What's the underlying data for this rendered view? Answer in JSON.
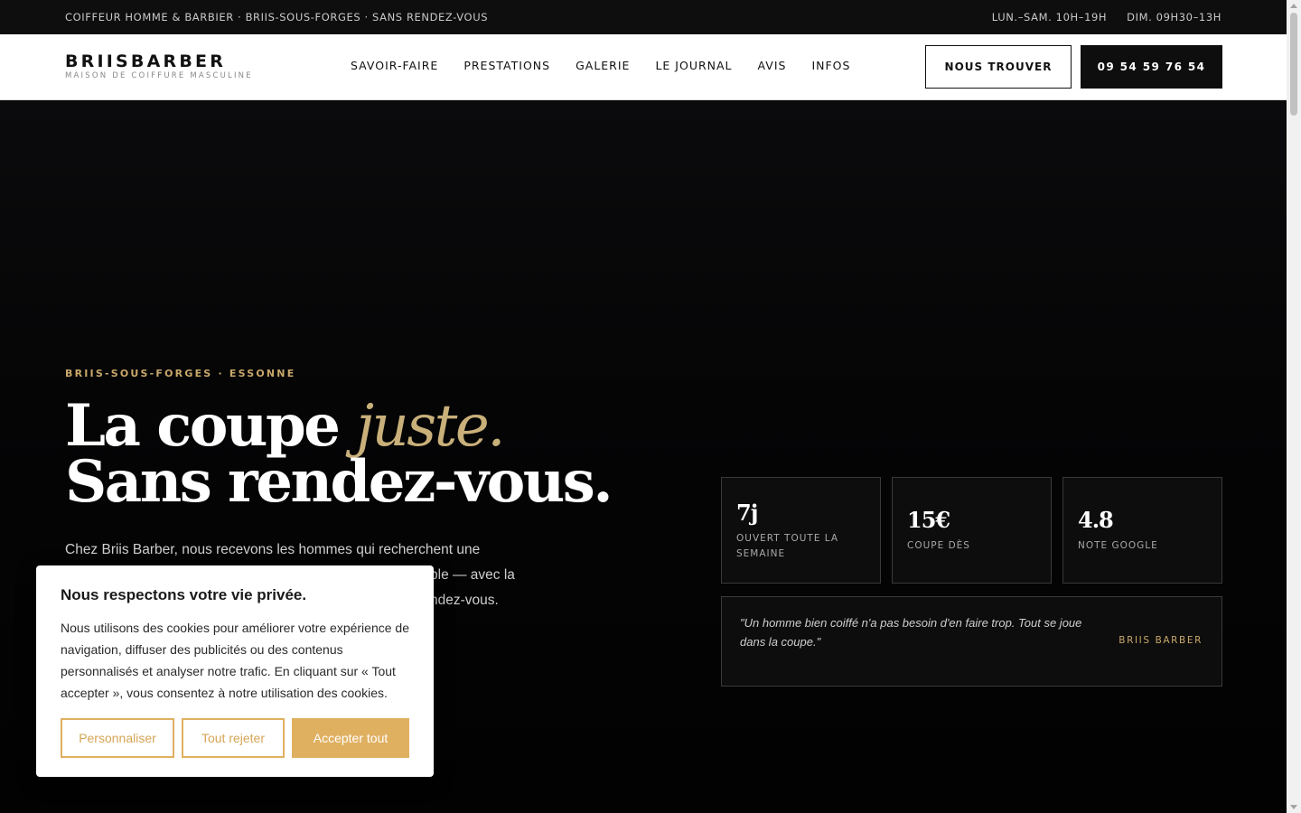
{
  "topbar": {
    "left": "COIFFEUR HOMME & BARBIER · BRIIS-SOUS-FORGES · SANS RENDEZ-VOUS",
    "hours_week": "LUN.–SAM. 10H–19H",
    "hours_sunday": "DIM. 09H30–13H"
  },
  "header": {
    "logo_title": "BRIISBARBER",
    "logo_subtitle": "MAISON DE COIFFURE MASCULINE",
    "nav": [
      "SAVOIR-FAIRE",
      "PRESTATIONS",
      "GALERIE",
      "LE JOURNAL",
      "AVIS",
      "INFOS"
    ],
    "cta_find": "NOUS TROUVER",
    "cta_phone": "09 54 59 76 54"
  },
  "hero": {
    "eyebrow": "BRIIS-SOUS-FORGES · ESSONNE",
    "headline_line1": "La coupe ",
    "headline_accent": "juste.",
    "headline_line2": "Sans rendez-vous.",
    "intro_line1": "Chez Briis Barber, nous recevons les hommes qui recherchent une",
    "intro_line2": "ble — avec la",
    "intro_line3": "ndez-vous.",
    "stats": [
      {
        "value": "7j",
        "label": "OUVERT TOUTE LA SEMAINE"
      },
      {
        "value": "15€",
        "label": "COUPE DÈS"
      },
      {
        "value": "4.8",
        "label": "NOTE GOOGLE"
      }
    ],
    "quote_text": "\"Un homme bien coiffé n'a pas besoin d'en faire trop. Tout se joue dans la coupe.\"",
    "quote_author": "BRIIS BARBER"
  },
  "cookie": {
    "title": "Nous respectons votre vie privée.",
    "text": "Nous utilisons des cookies pour améliorer votre expérience de navigation, diffuser des publicités ou des contenus personnalisés et analyser notre trafic. En cliquant sur « Tout accepter », vous consentez à notre utilisation des cookies.",
    "customize": "Personnaliser",
    "reject": "Tout rejeter",
    "accept": "Accepter tout"
  },
  "colors": {
    "accent_gold": "#c9a86a",
    "cookie_gold": "#e0b061",
    "dark": "#0e0e0e"
  }
}
